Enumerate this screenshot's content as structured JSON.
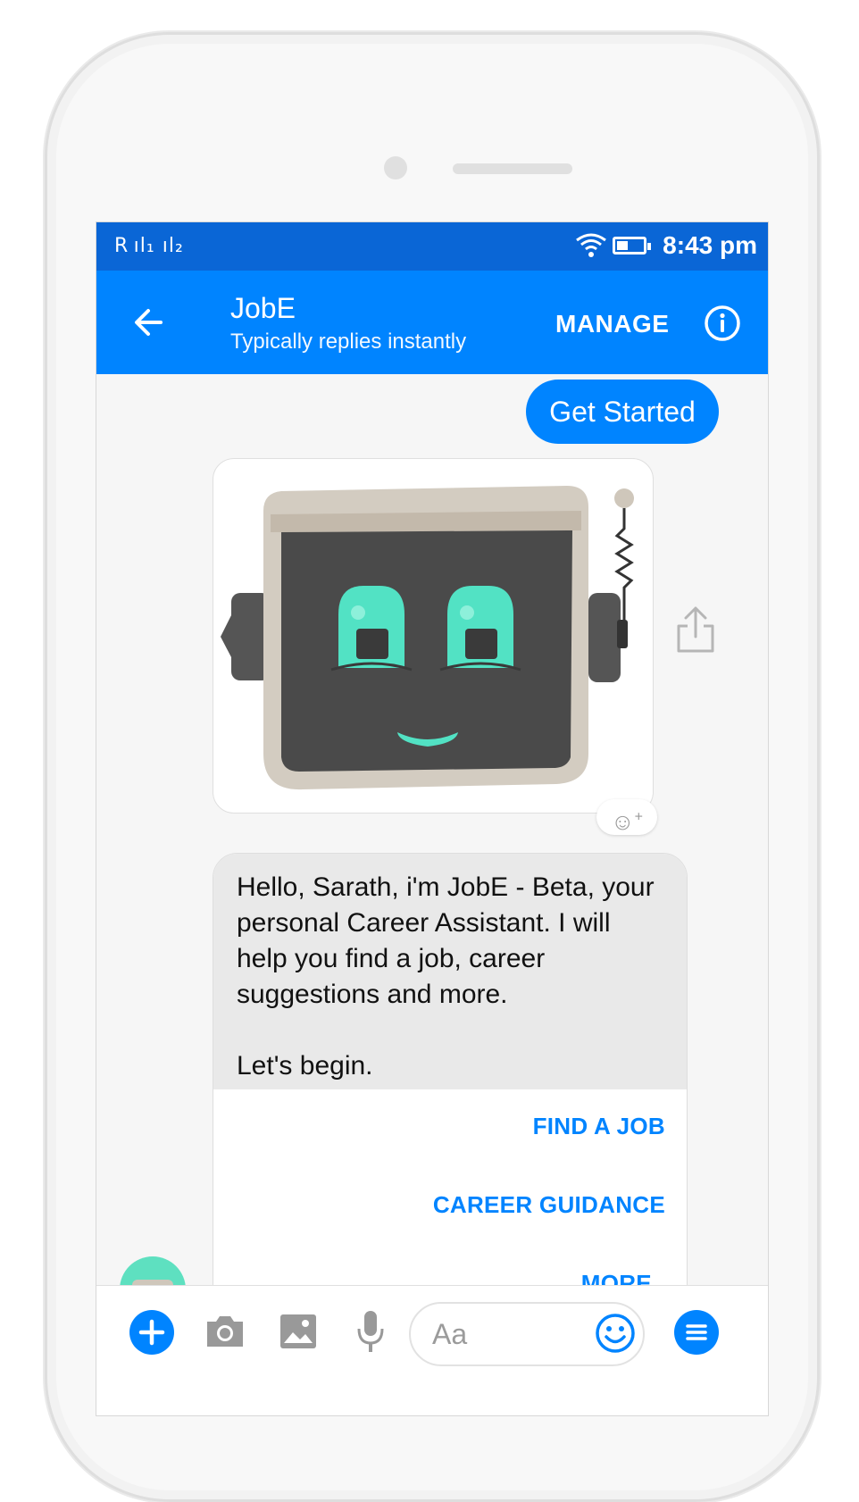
{
  "status_bar": {
    "signal": "R ıl₁ ıl₂",
    "time": "8:43 pm"
  },
  "header": {
    "title": "JobE",
    "subtitle": "Typically replies instantly",
    "manage_label": "MANAGE"
  },
  "chat": {
    "user_message": "Get Started",
    "bot_message": "Hello, Sarath, i'm JobE - Beta, your personal Career Assistant. I will help you find a job, career suggestions and more.\n\nLet's begin.",
    "quick_replies": [
      "FIND A JOB",
      "CAREER GUIDANCE",
      "MORE.."
    ],
    "reaction_icon": "emoji-plus-icon"
  },
  "composer": {
    "placeholder": "Aa",
    "icons": [
      "plus-icon",
      "camera-icon",
      "gallery-icon",
      "microphone-icon",
      "emoji-icon",
      "menu-icon"
    ]
  },
  "colors": {
    "status_bar": "#0a66d6",
    "app_bar": "#0084ff",
    "bot_bubble": "#e9e9e9",
    "accent": "#0084ff",
    "robot_mint": "#52e2c4",
    "robot_face": "#4a4a4a"
  }
}
